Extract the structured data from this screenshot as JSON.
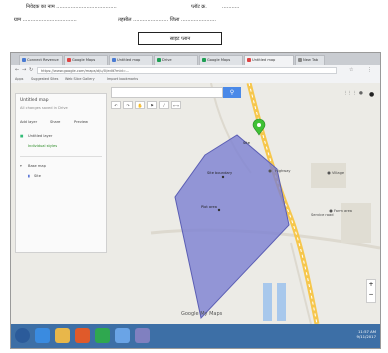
{
  "document": {
    "line1": {
      "left": "निवेदक का नाम ......................................",
      "mid": "प्लॉट क्र.",
      "right": "..........."
    },
    "line2": {
      "left": "ग्राम ..................................",
      "mid": "तहसील ...................... जिला ......................"
    },
    "boxed_label": "साइट प्लान"
  },
  "browser": {
    "tabs": [
      {
        "label": "Connect Revenue",
        "color": "#4a7bd3"
      },
      {
        "label": "Google Maps",
        "color": "#d44"
      },
      {
        "label": "Untitled map",
        "color": "#4a7bd3"
      },
      {
        "label": "Drive",
        "color": "#1e9e53"
      },
      {
        "label": "Google Maps",
        "color": "#1e9e53"
      },
      {
        "label": "Untitled map",
        "color": "#d44"
      },
      {
        "label": "New Tab",
        "color": "#888"
      }
    ],
    "url": "https://www.google.com/maps/d/u/0/edit?mid=...",
    "bookmarks": [
      "Apps",
      "Suggested Sites",
      "Web Slice Gallery",
      "Import bookmarks"
    ]
  },
  "map": {
    "left_panel": {
      "title": "Untitled map",
      "subtitle": "All changes saved in Drive",
      "actions": [
        "Add layer",
        "Share",
        "Preview"
      ],
      "layer1": "Untitled layer",
      "layer1_item": "Individual styles",
      "base_map": "Base map"
    },
    "labels": {
      "poly_center": "Site boundary",
      "poly_lower": "Plot area",
      "pin": "Site",
      "road_label1": "Highway",
      "road_label2": "Service road",
      "poi1": "Village",
      "poi2": "Farm area"
    },
    "footer_logo": "Google My Maps"
  },
  "taskbar": {
    "time": "11:57 AM",
    "date": "9/11/2017",
    "icons": [
      {
        "name": "start-icon",
        "color": "#2b5b9a"
      },
      {
        "name": "ie-icon",
        "color": "#3a8be0"
      },
      {
        "name": "explorer-icon",
        "color": "#e8b74a"
      },
      {
        "name": "media-icon",
        "color": "#e05a2a"
      },
      {
        "name": "chrome-icon",
        "color": "#2fa84f"
      },
      {
        "name": "paint-icon",
        "color": "#6aa4e6"
      },
      {
        "name": "tool-icon",
        "color": "#8080c0"
      }
    ]
  }
}
